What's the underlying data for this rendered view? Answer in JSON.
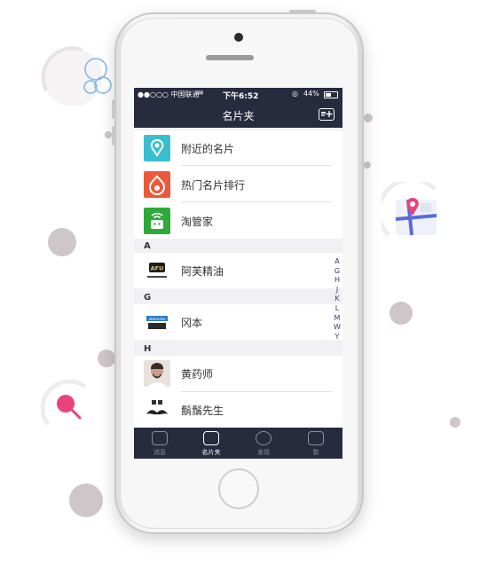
{
  "status_bar": {
    "carrier": "●●○○○ 中国联通",
    "time": "下午6:52",
    "battery": "44%"
  },
  "nav": {
    "title": "名片夹"
  },
  "top_items": [
    {
      "label": "附近的名片",
      "icon": "location-pin-icon",
      "color": "#3bbdd0"
    },
    {
      "label": "热门名片排行",
      "icon": "flame-icon",
      "color": "#ea5a3a"
    },
    {
      "label": "淘管家",
      "icon": "robot-wifi-icon",
      "color": "#2eaa3a"
    }
  ],
  "sections": [
    {
      "header": "A",
      "items": [
        {
          "label": "阿芙精油",
          "logo_text": "AFU"
        }
      ]
    },
    {
      "header": "G",
      "items": [
        {
          "label": "冈本",
          "logo_text": "okamoto"
        }
      ]
    },
    {
      "header": "H",
      "items": [
        {
          "label": "黄药师"
        },
        {
          "label": "鬍鬚先生"
        }
      ]
    }
  ],
  "index_letters": [
    "A",
    "G",
    "H",
    "J",
    "K",
    "L",
    "M",
    "W",
    "Y"
  ],
  "tabs": [
    {
      "label": "消息",
      "icon": "chat-icon",
      "active": false
    },
    {
      "label": "名片夹",
      "icon": "card-holder-icon",
      "active": true
    },
    {
      "label": "发现",
      "icon": "compass-icon",
      "active": false
    },
    {
      "label": "我",
      "icon": "profile-icon",
      "active": false
    }
  ],
  "colors": {
    "dark_navy": "#262b3e",
    "index_blue": "#2a3b74"
  }
}
